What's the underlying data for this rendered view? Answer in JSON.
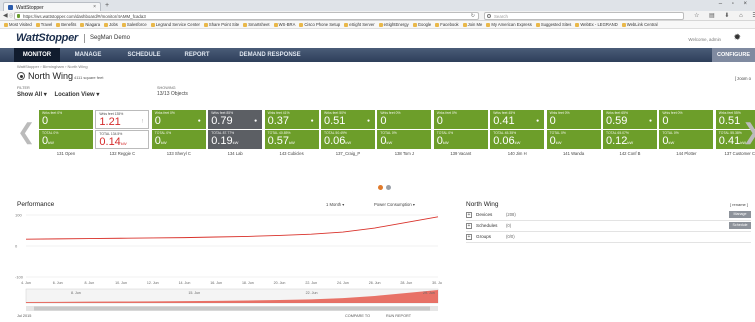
{
  "browser": {
    "tab_title": "WattStopper",
    "tab_close": "×",
    "new_tab": "+",
    "window_controls": "– ▫ ×",
    "url": "https://ws.wattstopper.com/dashboard/#/monitor/4AMM_fcada3",
    "search_placeholder": "Search",
    "bookmarks": [
      "Most Visited",
      "Travel",
      "Benefits",
      "Niagara",
      "Jobs",
      "Salesforce",
      "Legrand Service Center",
      "Share Point Site",
      "Smartsheet",
      "WS-BRA",
      "Cisco Phone Setup",
      "eSight Server",
      "eSightEnergy",
      "Google",
      "Facebook",
      "Join Me",
      "My American Express",
      "Suggested Sites",
      "WebEx - LEGRAND",
      "WebLink Central"
    ]
  },
  "app": {
    "logo": "WattStopper",
    "site_name": "SegMan Demo",
    "welcome": "Welcome, admin",
    "menu": [
      "MONITOR",
      "MANAGE",
      "SCHEDULE",
      "REPORT",
      "DEMAND RESPONSE"
    ],
    "config_button": "CONFIGURE",
    "breadcrumb": "WattStopper › Birmingham › North Wing"
  },
  "area": {
    "name": "North Wing",
    "size": "4111 square feet",
    "zoom_link": "[ zoom o",
    "filter_label": "FILTER",
    "filter_show": "Show All",
    "filter_location": "Location View",
    "showing_label": "SHOWING",
    "showing_value": "13/13 Objects"
  },
  "tiles": [
    {
      "name": "131 Open",
      "top_label": "Wrks feet  0%",
      "top_value": "0",
      "bot_label": "TOTAL  0%",
      "bot_value": "0",
      "unit": "kW",
      "icon": "",
      "style": "green"
    },
    {
      "name": "132 Reggie C",
      "top_label": "Wrks feet  135%",
      "top_value": "1.21",
      "bot_label": "TOTAL  134.5%",
      "bot_value": "0.14",
      "unit": "kW",
      "icon": "!",
      "style": "selected"
    },
    {
      "name": "133 Sheryl C",
      "top_label": "Wrks feet  0%",
      "top_value": "0",
      "bot_label": "TOTAL  0%",
      "bot_value": "0",
      "unit": "kW",
      "icon": "●",
      "style": "green"
    },
    {
      "name": "134 Lab",
      "top_label": "Wrks feet  85%",
      "top_value": "0.79",
      "bot_label": "TOTAL  87.77%",
      "bot_value": "0.19",
      "unit": "kW",
      "icon": "●",
      "style": "dark"
    },
    {
      "name": "143 Cubicles",
      "top_label": "Wrks feet  41%",
      "top_value": "0.37",
      "bot_label": "TOTAL  40.85%",
      "bot_value": "0.57",
      "unit": "kW",
      "icon": "●",
      "style": "green"
    },
    {
      "name": "137_Craig_P",
      "top_label": "Wrks feet  50%",
      "top_value": "0.51",
      "bot_label": "TOTAL  50.49%",
      "bot_value": "0.06",
      "unit": "kW",
      "icon": "●",
      "style": "green"
    },
    {
      "name": "138 Tom J",
      "top_label": "Wrks feet  0%",
      "top_value": "0",
      "bot_label": "TOTAL  0%",
      "bot_value": "0",
      "unit": "kW",
      "icon": "",
      "style": "green"
    },
    {
      "name": "139 Vacant",
      "top_label": "Wrks feet  0%",
      "top_value": "0",
      "bot_label": "TOTAL  0%",
      "bot_value": "0",
      "unit": "kW",
      "icon": "",
      "style": "green"
    },
    {
      "name": "140 Jim H",
      "top_label": "Wrks feet  45%",
      "top_value": "0.41",
      "bot_label": "TOTAL  45.35%",
      "bot_value": "0.06",
      "unit": "kW",
      "icon": "●",
      "style": "green"
    },
    {
      "name": "141 Wanda",
      "top_label": "Wrks feet  0%",
      "top_value": "0",
      "bot_label": "TOTAL  0%",
      "bot_value": "0",
      "unit": "kW",
      "icon": "",
      "style": "green"
    },
    {
      "name": "142 Conf B",
      "top_label": "Wrks feet  65%",
      "top_value": "0.59",
      "bot_label": "TOTAL  65.07%",
      "bot_value": "0.12",
      "unit": "kW",
      "icon": "●",
      "style": "green"
    },
    {
      "name": "144 Plotter",
      "top_label": "Wrks feet  0%",
      "top_value": "0",
      "bot_label": "TOTAL  0%",
      "bot_value": "0",
      "unit": "kW",
      "icon": "",
      "style": "green"
    },
    {
      "name": "137 Customer Care",
      "top_label": "Wrks feet  55%",
      "top_value": "0.51",
      "bot_label": "TOTAL  55.38%",
      "bot_value": "0.41",
      "unit": "kW",
      "icon": "●",
      "style": "green"
    }
  ],
  "pager": {
    "active_color": "#e07a2b",
    "inactive_color": "#9aa0a8"
  },
  "performance": {
    "title": "Performance",
    "range": "1 Month",
    "metric": "Power Consumption",
    "date_label": "Jul 2015",
    "compare_label": "COMPARE TO",
    "run_report_label": "RUN REPORT",
    "line_color": "#d9322b"
  },
  "chart_data": {
    "type": "area",
    "title": "Performance",
    "ytick_labels": [
      "100",
      "0",
      "-100"
    ],
    "ylim": [
      -100,
      100
    ],
    "x": [
      "4. Jun",
      "6. Jun",
      "8. Jun",
      "10. Jun",
      "12. Jun",
      "14. Jun",
      "16. Jun",
      "18. Jun",
      "20. Jun",
      "22. Jun",
      "24. Jun",
      "26. Jun",
      "28. Jun",
      "30. Jun"
    ],
    "navigator_labels": [
      "8. Jun",
      "15. Jun",
      "22. Jun",
      "29. Jun"
    ],
    "series": [
      {
        "values": [
          22,
          23,
          24,
          25,
          26,
          27,
          29,
          31,
          34,
          38,
          45,
          58,
          76,
          94
        ]
      }
    ]
  },
  "north_wing": {
    "title": "North Wing",
    "rename": "[ rename ]",
    "rows": [
      {
        "label": "Devices",
        "count": "(208)",
        "button": "Manage"
      },
      {
        "label": "Schedules",
        "count": "(0)",
        "button": "Schedule"
      },
      {
        "label": "Groups",
        "count": "(0/0)",
        "button": ""
      }
    ]
  }
}
